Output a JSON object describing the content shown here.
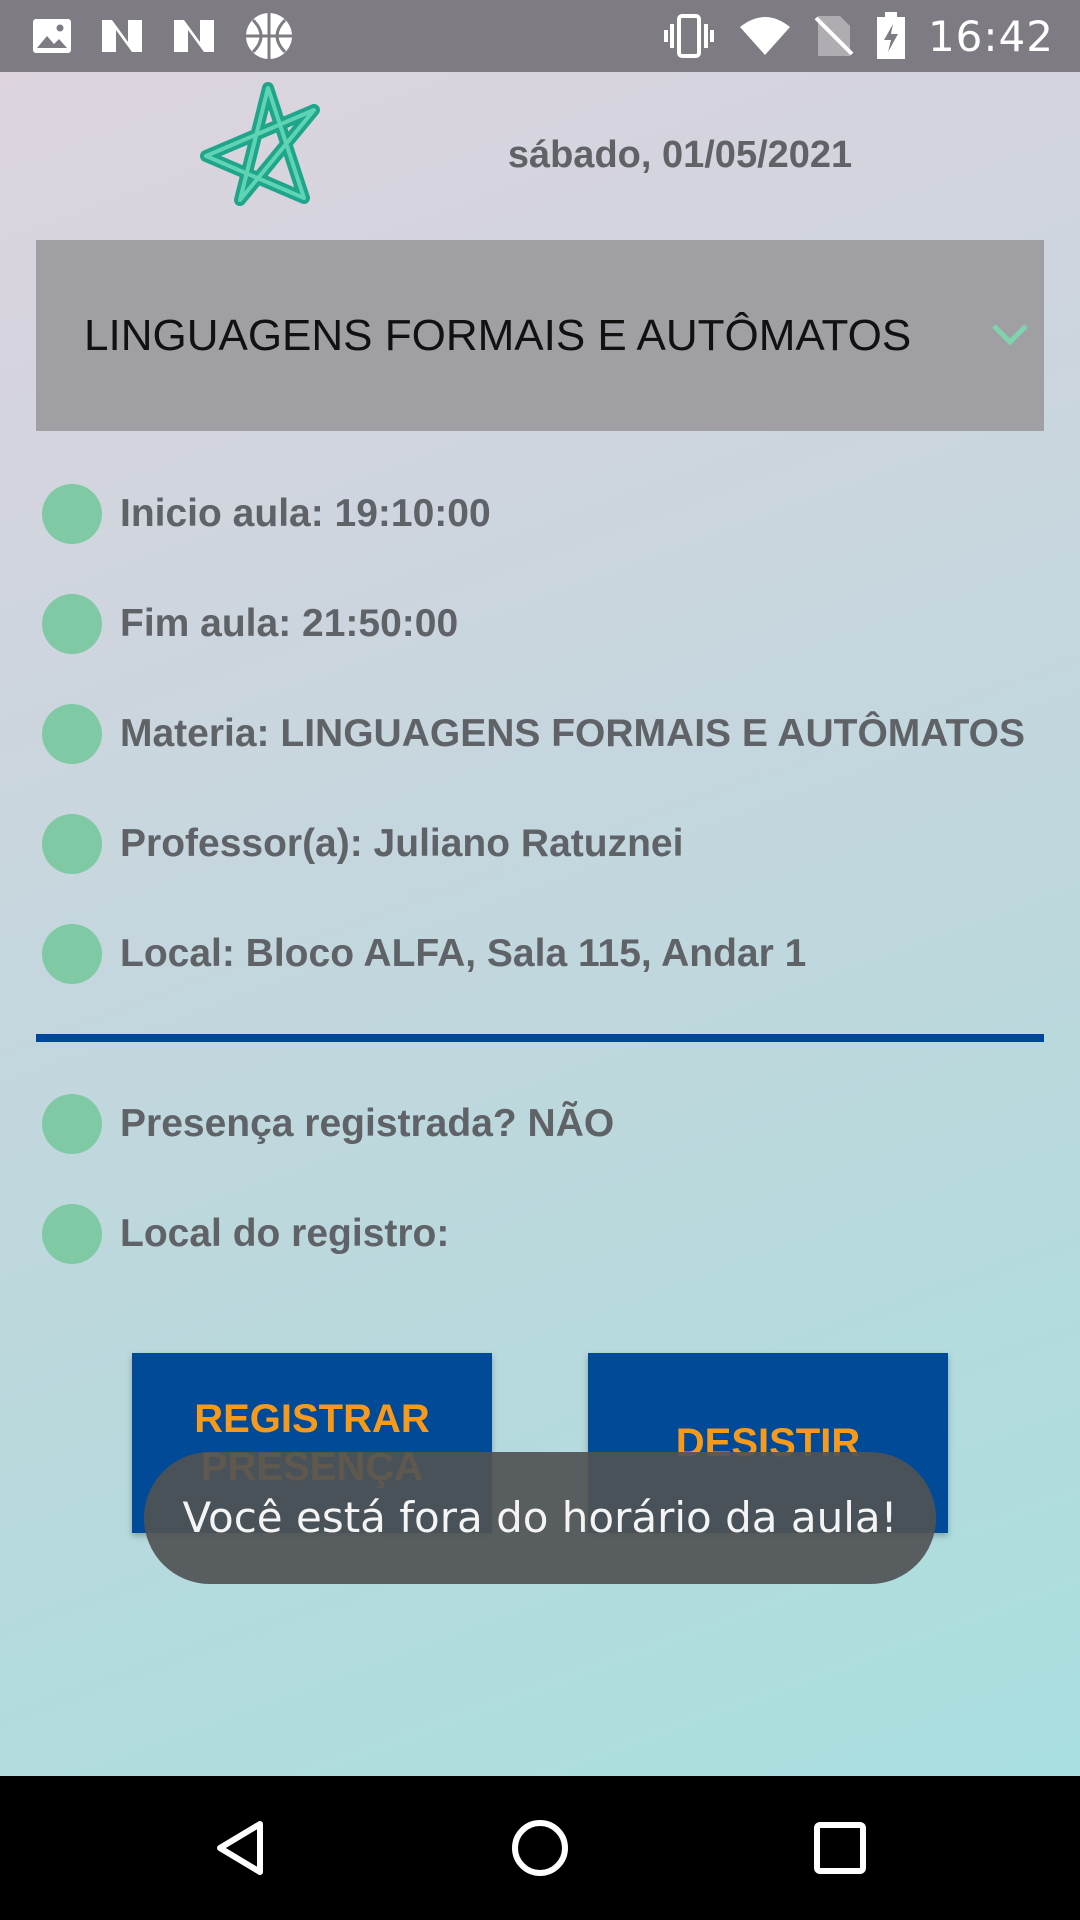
{
  "status_bar": {
    "time": "16:42",
    "left_icons": [
      "image-icon",
      "n-app-icon",
      "n-app-icon",
      "basketball-icon"
    ],
    "right_icons": [
      "vibrate-icon",
      "wifi-icon",
      "no-sim-icon",
      "battery-charging-icon"
    ]
  },
  "header": {
    "date": "sábado, 01/05/2021",
    "logo": "star-logo"
  },
  "subject_select": {
    "selected": "LINGUAGENS FORMAIS E AUTÔMATOS",
    "icon": "chevron-down-icon"
  },
  "class_info": [
    {
      "text": "Inicio aula: 19:10:00"
    },
    {
      "text": "Fim aula: 21:50:00"
    },
    {
      "text": "Materia: LINGUAGENS FORMAIS E AUTÔMATOS"
    },
    {
      "text": "Professor(a): Juliano Ratuznei"
    },
    {
      "text": "Local: Bloco ALFA, Sala 115, Andar 1"
    }
  ],
  "attendance_info": [
    {
      "text": "Presença registrada? NÃO"
    },
    {
      "text": "Local do registro:"
    }
  ],
  "actions": {
    "register_label": "REGISTRAR PRESENÇA",
    "quit_label": "DESISTIR"
  },
  "toast": {
    "message": "Você está fora do horário da aula!"
  },
  "colors": {
    "accent_blue": "#004a97",
    "button_text": "#f79a1c",
    "dot_green": "#7fcaa4",
    "logo_teal": "#1fa68a"
  },
  "nav_bar": [
    "back-icon",
    "home-icon",
    "recents-icon"
  ]
}
